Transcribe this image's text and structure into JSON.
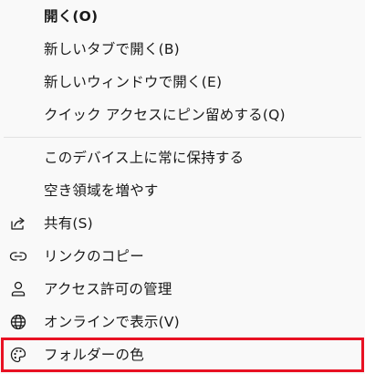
{
  "menu": {
    "items": [
      {
        "id": "open",
        "label": "開く(O)",
        "bold": true,
        "icon": null
      },
      {
        "id": "open-new-tab",
        "label": "新しいタブで開く(B)",
        "icon": null
      },
      {
        "id": "open-new-window",
        "label": "新しいウィンドウで開く(E)",
        "icon": null
      },
      {
        "id": "pin-quick-access",
        "label": "クイック アクセスにピン留めする(Q)",
        "icon": null
      },
      {
        "id": "always-keep",
        "label": "このデバイス上に常に保持する",
        "icon": null
      },
      {
        "id": "free-space",
        "label": "空き領域を増やす",
        "icon": null
      },
      {
        "id": "share",
        "label": "共有(S)",
        "icon": "share-icon"
      },
      {
        "id": "copy-link",
        "label": "リンクのコピー",
        "icon": "link-icon"
      },
      {
        "id": "manage-access",
        "label": "アクセス許可の管理",
        "icon": "person-icon"
      },
      {
        "id": "view-online",
        "label": "オンラインで表示(V)",
        "icon": "globe-icon"
      },
      {
        "id": "folder-color",
        "label": "フォルダーの色",
        "icon": "palette-icon",
        "highlighted": true
      }
    ]
  },
  "colors": {
    "highlight_border": "#e81123",
    "background": "#f9f9f9",
    "separator": "#e2e2e2",
    "text": "#1a1a1a"
  }
}
